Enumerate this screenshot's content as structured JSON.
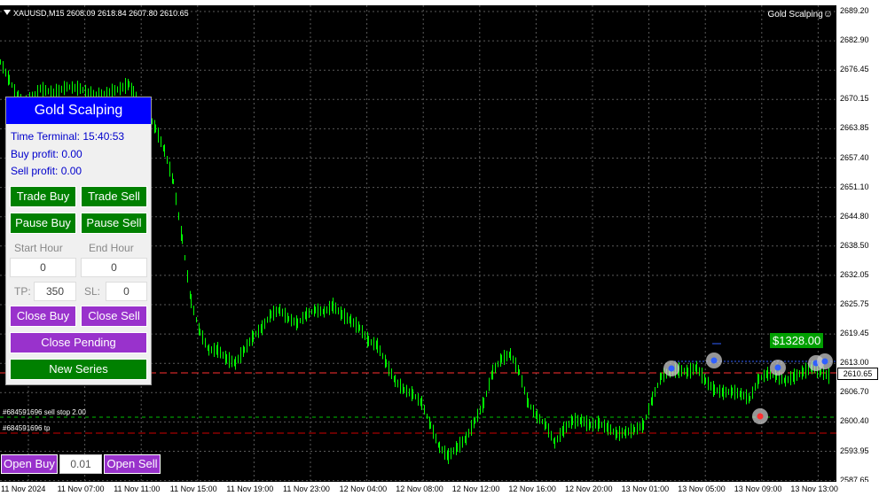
{
  "chart": {
    "symbol_info": "XAUUSD,M15  2608.09 2618.84 2607.80 2610.65",
    "ea_name": "Gold Scalping",
    "ea_icon": "smiley-icon",
    "current_price": "2610.65",
    "price_ticks": [
      "2689.20",
      "2682.90",
      "2676.45",
      "2670.15",
      "2663.85",
      "2657.40",
      "2651.10",
      "2644.80",
      "2638.50",
      "2632.05",
      "2625.75",
      "2619.45",
      "2613.00",
      "2606.70",
      "2600.40",
      "2593.95",
      "2587.65"
    ],
    "time_ticks": [
      "11 Nov 2024",
      "11 Nov 07:00",
      "11 Nov 11:00",
      "11 Nov 15:00",
      "11 Nov 19:00",
      "11 Nov 23:00",
      "12 Nov 04:00",
      "12 Nov 08:00",
      "12 Nov 12:00",
      "12 Nov 16:00",
      "12 Nov 20:00",
      "13 Nov 01:00",
      "13 Nov 05:00",
      "13 Nov 09:00",
      "13 Nov 13:00"
    ],
    "order_label_sell_stop": "#684591696 sell stop 2.00",
    "order_label_tp": "#684591696 tp",
    "profit_tag": "$1328.00",
    "colors": {
      "candles": "#00ff00",
      "grid": "#5a5a5a",
      "sell_line": "#ff3030",
      "tp_line": "#00c000",
      "bid_line": "#cc0000"
    }
  },
  "panel": {
    "title": "Gold Scalping",
    "time_terminal": "Time Terminal: 15:40:53",
    "buy_profit": "Buy profit: 0.00",
    "sell_profit": "Sell profit: 0.00",
    "trade_buy": "Trade Buy",
    "trade_sell": "Trade Sell",
    "pause_buy": "Pause Buy",
    "pause_sell": "Pause Sell",
    "start_hour_label": "Start Hour",
    "end_hour_label": "End Hour",
    "start_hour_value": "0",
    "end_hour_value": "0",
    "tp_label": "TP:",
    "tp_value": "350",
    "sl_label": "SL:",
    "sl_value": "0",
    "close_buy": "Close Buy",
    "close_sell": "Close Sell",
    "close_pending": "Close Pending",
    "new_series": "New Series",
    "colors": {
      "title_bg": "#0000ff",
      "green_btn": "#008000",
      "purple_btn": "#9932cc",
      "info_text": "#0000cc"
    }
  },
  "bottom_bar": {
    "open_buy": "Open Buy",
    "lot_value": "0.01",
    "open_sell": "Open Sell"
  }
}
